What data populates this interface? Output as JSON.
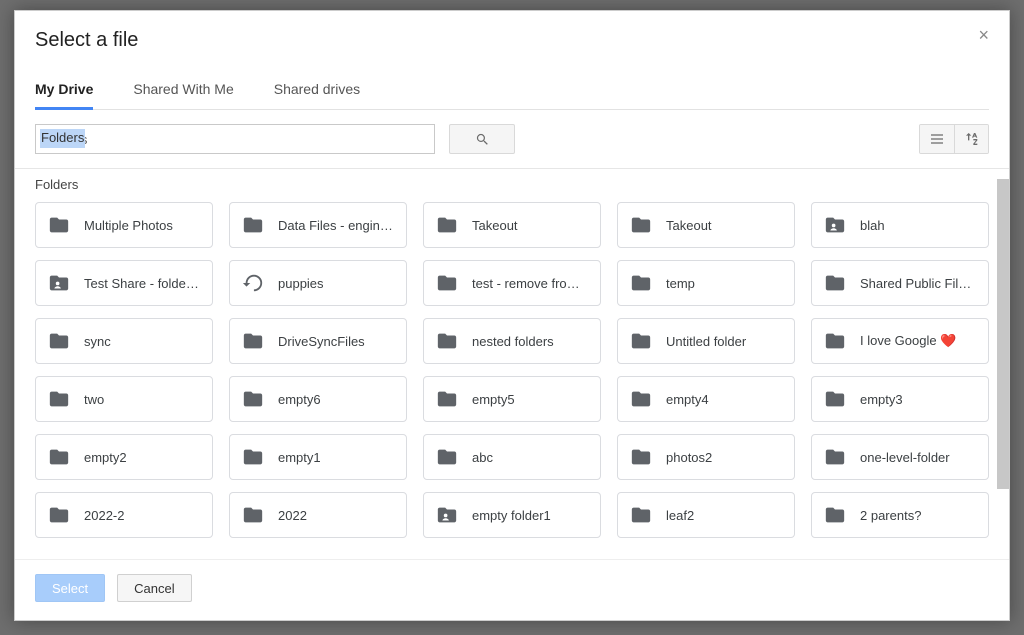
{
  "dialog": {
    "title": "Select a file",
    "close_label": "×"
  },
  "tabs": [
    {
      "label": "My Drive",
      "active": true
    },
    {
      "label": "Shared With Me",
      "active": false
    },
    {
      "label": "Shared drives",
      "active": false
    }
  ],
  "search": {
    "value": "Folders",
    "placeholder": ""
  },
  "section": {
    "label": "Folders"
  },
  "folders": [
    {
      "label": "Multiple Photos",
      "icon": "folder"
    },
    {
      "label": "Data Files - engineering archive",
      "icon": "folder"
    },
    {
      "label": "Takeout",
      "icon": "folder"
    },
    {
      "label": "Takeout",
      "icon": "folder"
    },
    {
      "label": "blah",
      "icon": "shared"
    },
    {
      "label": "Test Share - folder contents",
      "icon": "shared"
    },
    {
      "label": "puppies",
      "icon": "restore"
    },
    {
      "label": "test - remove from drive",
      "icon": "folder"
    },
    {
      "label": "temp",
      "icon": "folder"
    },
    {
      "label": "Shared Public Files…",
      "icon": "folder"
    },
    {
      "label": "sync",
      "icon": "folder"
    },
    {
      "label": "DriveSyncFiles",
      "icon": "folder"
    },
    {
      "label": "nested folders",
      "icon": "folder"
    },
    {
      "label": "Untitled folder",
      "icon": "folder"
    },
    {
      "label": "I love Google ❤️",
      "icon": "folder"
    },
    {
      "label": "two",
      "icon": "folder"
    },
    {
      "label": "empty6",
      "icon": "folder"
    },
    {
      "label": "empty5",
      "icon": "folder"
    },
    {
      "label": "empty4",
      "icon": "folder"
    },
    {
      "label": "empty3",
      "icon": "folder"
    },
    {
      "label": "empty2",
      "icon": "folder"
    },
    {
      "label": "empty1",
      "icon": "folder"
    },
    {
      "label": "abc",
      "icon": "folder"
    },
    {
      "label": "photos2",
      "icon": "folder"
    },
    {
      "label": "one-level-folder",
      "icon": "folder"
    },
    {
      "label": "2022-2",
      "icon": "folder"
    },
    {
      "label": "2022",
      "icon": "folder"
    },
    {
      "label": "empty folder1",
      "icon": "shared"
    },
    {
      "label": "leaf2",
      "icon": "folder"
    },
    {
      "label": "2 parents?",
      "icon": "folder"
    }
  ],
  "footer": {
    "select_label": "Select",
    "cancel_label": "Cancel"
  }
}
